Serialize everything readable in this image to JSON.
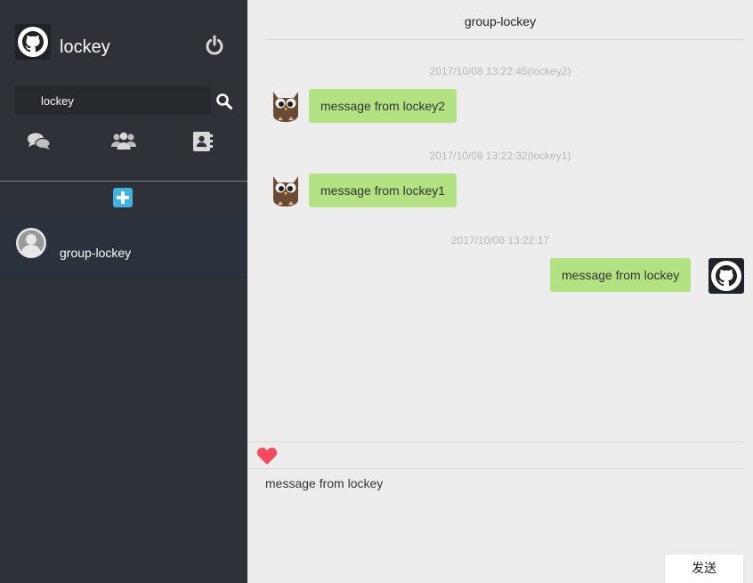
{
  "user": {
    "name": "lockey"
  },
  "search": {
    "value": "lockey",
    "placeholder": ""
  },
  "session": {
    "name": "group-lockey"
  },
  "chat": {
    "title": "group-lockey",
    "messages": [
      {
        "time": "2017/10/08 13:22:45(lockey2)",
        "text": "message from lockey2",
        "self": false
      },
      {
        "time": "2017/10/08 13:22:32(lockey1)",
        "text": "message from lockey1",
        "self": false
      },
      {
        "time": "2017/10/08 13:22:17",
        "text": "message from lockey",
        "self": true
      }
    ]
  },
  "composer": {
    "value": "message from lockey",
    "send_label": "发送"
  },
  "colors": {
    "sidebar": "#2e3238",
    "bubble": "#b2e281",
    "accent": "#3fb2e0",
    "heart": "#f54a5d"
  },
  "icons": [
    "github-icon",
    "power-icon",
    "search-icon",
    "chat-icon",
    "group-icon",
    "contacts-icon",
    "add-icon",
    "user-icon",
    "owl-icon",
    "heart-icon"
  ]
}
